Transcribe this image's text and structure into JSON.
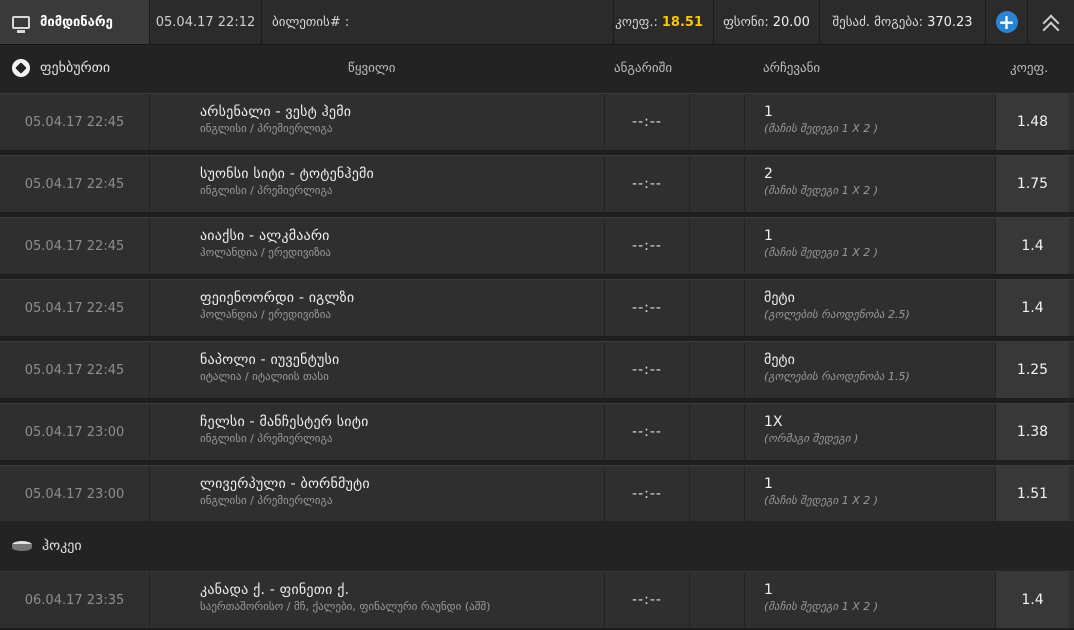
{
  "topbar": {
    "current_label": "მიმდინარე",
    "date": "05.04.17 22:12",
    "ticket_label": "ბილეთის# :",
    "coef_label": "კოეფ.:",
    "coef_value": "18.51",
    "stake_label": "ფსონი:",
    "stake_value": "20.00",
    "win_label": "შესაძ. მოგება:",
    "win_value": "370.23"
  },
  "header": {
    "sport": "ფეხბურთი",
    "col_pair": "წყვილი",
    "col_score": "ანგარიში",
    "col_choice": "არჩევანი",
    "col_coef": "კოეფ."
  },
  "football": [
    {
      "date": "05.04.17 22:45",
      "match": "არსენალი - ვესტ ჰემი",
      "league": "ინგლისი / პრემიერლიგა",
      "score": "--:--",
      "choice": "1",
      "market": "(მაჩის შედეგი 1 X 2 )",
      "odd": "1.48"
    },
    {
      "date": "05.04.17 22:45",
      "match": "სუონსი სიტი - ტოტენჰემი",
      "league": "ინგლისი / პრემიერლიგა",
      "score": "--:--",
      "choice": "2",
      "market": "(მაჩის შედეგი 1 X 2 )",
      "odd": "1.75"
    },
    {
      "date": "05.04.17 22:45",
      "match": "აიაქსი - ალკმაარი",
      "league": "ჰოლანდია / ერედივიზია",
      "score": "--:--",
      "choice": "1",
      "market": "(მაჩის შედეგი 1 X 2 )",
      "odd": "1.4"
    },
    {
      "date": "05.04.17 22:45",
      "match": "ფეიენოორდი - იგლზი",
      "league": "ჰოლანდია / ერედივიზია",
      "score": "--:--",
      "choice": "მეტი",
      "market": "(გოლების რაოდენობა 2.5)",
      "odd": "1.4"
    },
    {
      "date": "05.04.17 22:45",
      "match": "ნაპოლი - იუვენტუსი",
      "league": "იტალია / იტალიის თასი",
      "score": "--:--",
      "choice": "მეტი",
      "market": "(გოლების რაოდენობა 1.5)",
      "odd": "1.25"
    },
    {
      "date": "05.04.17 23:00",
      "match": "ჩელსი - მანჩესტერ სიტი",
      "league": "ინგლისი / პრემიერლიგა",
      "score": "--:--",
      "choice": "1X",
      "market": "(ორმაგი შედეგი )",
      "odd": "1.38"
    },
    {
      "date": "05.04.17 23:00",
      "match": "ლივერპული - ბორნმუტი",
      "league": "ინგლისი / პრემიერლიგა",
      "score": "--:--",
      "choice": "1",
      "market": "(მაჩის შედეგი 1 X 2 )",
      "odd": "1.51"
    }
  ],
  "hockey_label": "ჰოკეი",
  "hockey": [
    {
      "date": "06.04.17 23:35",
      "match": "კანადა ქ. - ფინეთი ქ.",
      "league": "საერთაშორისო / მჩ, ქალები, ფინალური რაუნდი (აშშ)",
      "score": "--:--",
      "choice": "1",
      "market": "(მაჩის შედეგი 1 X 2 )",
      "odd": "1.4"
    }
  ]
}
